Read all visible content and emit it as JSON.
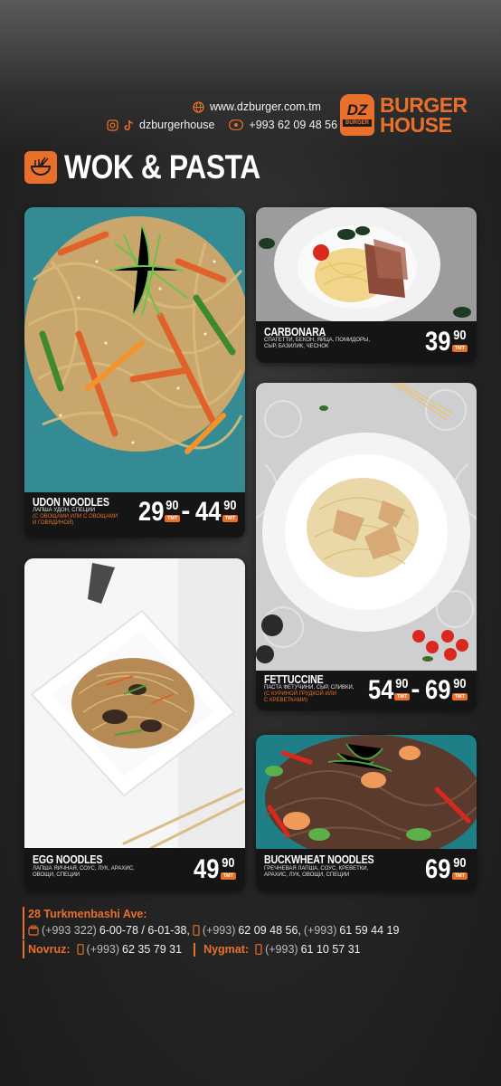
{
  "header": {
    "website": "www.dzburger.com.tm",
    "social_handle": "dzburgerhouse",
    "phone": "+993 62 09 48 56",
    "logo": {
      "badge_text": "DZ",
      "badge_sub": "BURGER",
      "word1": "BURGER",
      "word2": "HOUSE"
    }
  },
  "section": {
    "title": "WOK & PASTA",
    "icon": "noodle-bowl-icon"
  },
  "menu": [
    {
      "name": "UDON NOODLES",
      "desc1": "ЛАПША УДОН, СПЕЦИИ",
      "desc2": "(С ОВОЩАМИ или С ОВОЩАМИ",
      "desc3": "И ГОВЯДИНОЙ)",
      "price1_main": "29",
      "price1_cents": "90",
      "price2_main": "44",
      "price2_cents": "90",
      "currency": "ТМТ"
    },
    {
      "name": "CARBONARA",
      "desc1": "СПАГЕТТИ, БЕКОН, ЯЙЦА, ПОМИДОРЫ,",
      "desc2": "СЫР, БАЗИЛИК, ЧЕСНОК",
      "price_main": "39",
      "price_cents": "90",
      "currency": "ТМТ"
    },
    {
      "name": "FETTUCCINE",
      "desc1": "ПАСТА ФЕТУЧИНИ, СЫР, СЛИВКИ,",
      "desc2": "(С КУРИНОЙ ГРУДКОЙ или",
      "desc3": "С КРЕВЕТКАМИ)",
      "price1_main": "54",
      "price1_cents": "90",
      "price2_main": "69",
      "price2_cents": "90",
      "currency": "ТМТ"
    },
    {
      "name": "EGG NOODLES",
      "desc1": "ЛАПША ЯИЧНАЯ, СОУС, ЛУК, АРАХИС,",
      "desc2": "ОВОЩИ, СПЕЦИИ",
      "price_main": "49",
      "price_cents": "90",
      "currency": "ТМТ"
    },
    {
      "name": "BUCKWHEAT NOODLES",
      "desc1": "ГРЕЧНЕВАЯ ЛАПША, СОУС, КРЕВЕТКИ,",
      "desc2": "АРАХИС, ЛУК, ОВОЩИ, СПЕЦИИ",
      "price_main": "69",
      "price_cents": "90",
      "currency": "ТМТ"
    }
  ],
  "footer": {
    "address": "28 Turkmenbashi Ave:",
    "landline_prefix": "(+993 322)",
    "landline": "6-00-78 / 6-01-38,",
    "mobile1_prefix": "(+993)",
    "mobile1": "62 09 48 56,",
    "mobile2_prefix": "(+993)",
    "mobile2": "61 59 44 19",
    "branch1_name": "Novruz:",
    "branch1_prefix": "(+993)",
    "branch1_phone": "62 35 79 31",
    "branch2_name": "Nygmat:",
    "branch2_prefix": "(+993)",
    "branch2_phone": "61 10 57 31"
  }
}
